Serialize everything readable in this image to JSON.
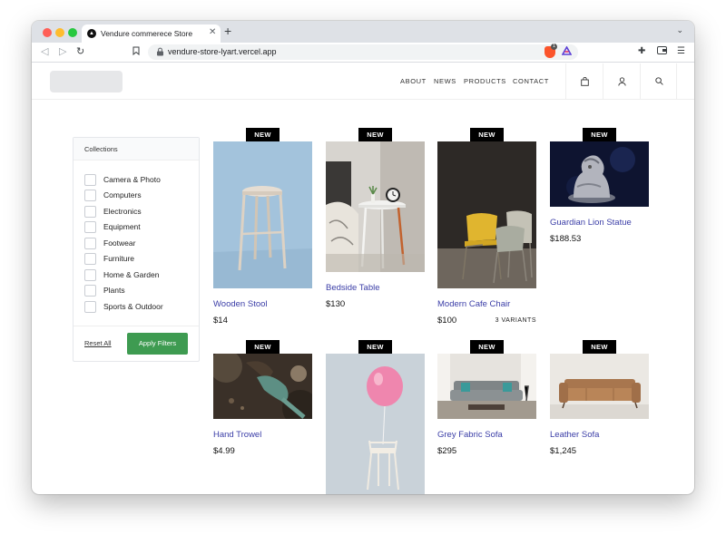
{
  "browser": {
    "tab_title": "Vendure commerece Store",
    "url": "vendure-store-lyart.vercel.app",
    "shield_count": "1",
    "icons": [
      "back-icon",
      "forward-icon",
      "reload-icon",
      "bookmark-icon",
      "lock-icon",
      "brave-shield-icon",
      "brave-rewards-icon",
      "extensions-icon",
      "wallet-icon",
      "menu-icon"
    ]
  },
  "header": {
    "nav": [
      "ABOUT",
      "NEWS",
      "PRODUCTS",
      "CONTACT"
    ],
    "icons": [
      "bag-icon",
      "user-icon",
      "search-icon"
    ]
  },
  "filters": {
    "title": "Collections",
    "collections": [
      "Camera & Photo",
      "Computers",
      "Electronics",
      "Equipment",
      "Footwear",
      "Furniture",
      "Home & Garden",
      "Plants",
      "Sports & Outdoor"
    ],
    "reset_label": "Reset All",
    "apply_label": "Apply Filters",
    "apply_color": "#3e9b51"
  },
  "badge_label": "NEW",
  "products": [
    {
      "name": "Wooden Stool",
      "price": "$14",
      "variants": ""
    },
    {
      "name": "Bedside Table",
      "price": "$130",
      "variants": ""
    },
    {
      "name": "Modern Cafe Chair",
      "price": "$100",
      "variants": "3 VARIANTS"
    },
    {
      "name": "Guardian Lion Statue",
      "price": "$188.53",
      "variants": ""
    },
    {
      "name": "Hand Trowel",
      "price": "$4.99",
      "variants": ""
    },
    {
      "name": "",
      "price": "",
      "variants": ""
    },
    {
      "name": "Grey Fabric Sofa",
      "price": "$295",
      "variants": ""
    },
    {
      "name": "Leather Sofa",
      "price": "$1,245",
      "variants": ""
    }
  ],
  "colors": {
    "product_link": "#3b3ea7",
    "badge_bg": "#000000"
  }
}
